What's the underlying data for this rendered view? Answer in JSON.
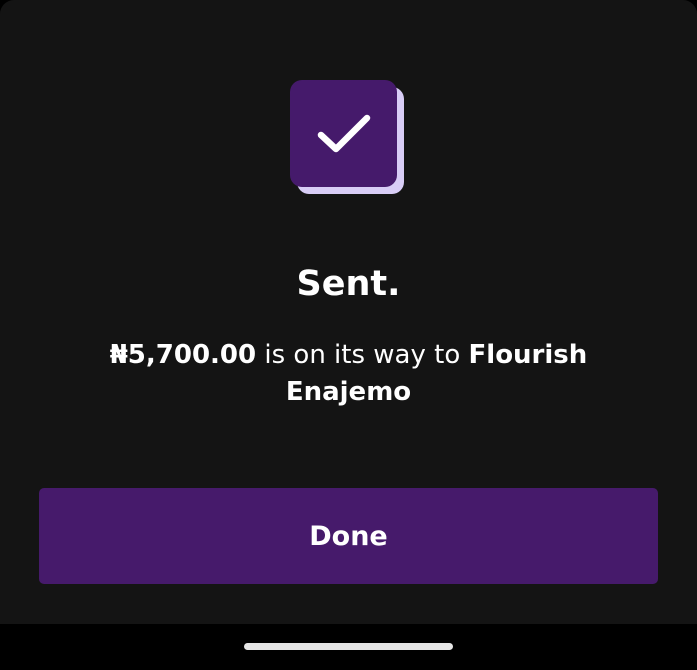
{
  "confirmation": {
    "title": "Sent.",
    "amount": "₦5,700.00",
    "message_middle": " is on its way to ",
    "recipient": "Flourish Enajemo",
    "icon": "checkmark-icon"
  },
  "actions": {
    "done_label": "Done"
  },
  "colors": {
    "background": "#141414",
    "accent": "#461a6b",
    "icon_shadow": "#d8cdf6",
    "text": "#ffffff"
  }
}
